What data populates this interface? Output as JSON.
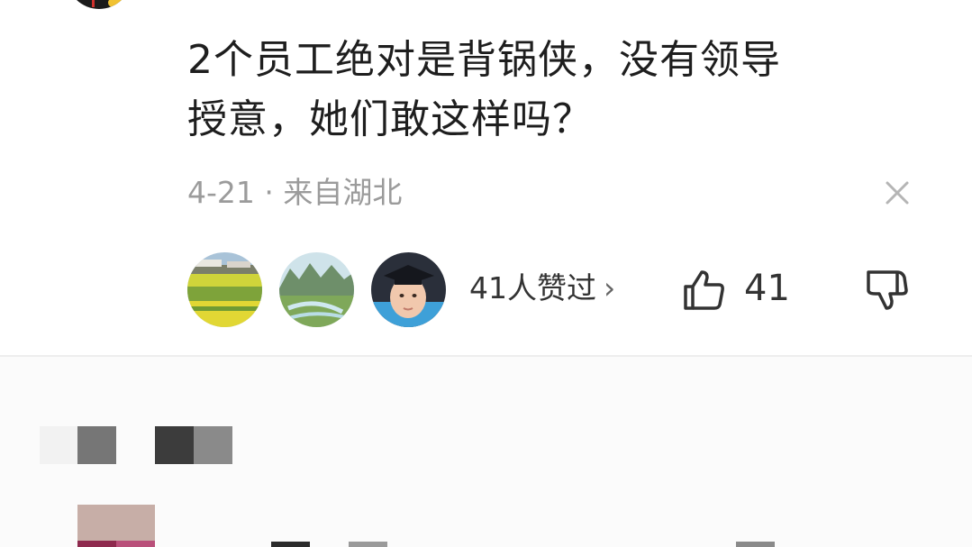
{
  "comment": {
    "line1": "2个员工绝对是背锅侠，没有领导",
    "line2": "授意，她们敢这样吗？",
    "meta": "4-21 · 来自湖北"
  },
  "likes": {
    "summary": "41人赞过",
    "chevron": "›",
    "count": "41"
  },
  "icons": {
    "close": "close-icon",
    "thumbs_up": "thumbs-up-icon",
    "thumbs_down": "thumbs-down-icon",
    "chevron": "chevron-right-icon"
  },
  "colors": {
    "text": "#1e1e1e",
    "meta": "#9b9b9b",
    "divider": "#eeeeee"
  }
}
